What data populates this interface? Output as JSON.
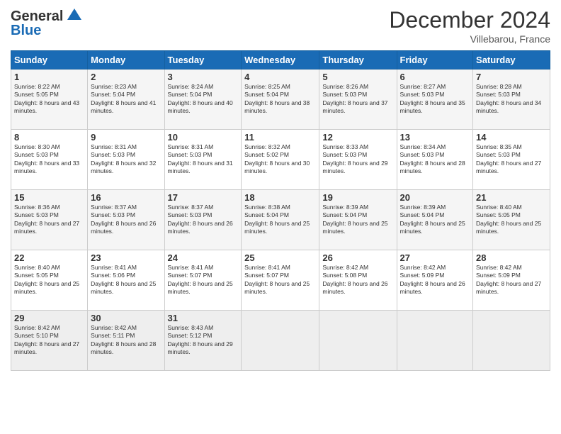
{
  "logo": {
    "line1": "General",
    "line2": "Blue"
  },
  "title": "December 2024",
  "subtitle": "Villebarou, France",
  "headers": [
    "Sunday",
    "Monday",
    "Tuesday",
    "Wednesday",
    "Thursday",
    "Friday",
    "Saturday"
  ],
  "weeks": [
    [
      {
        "day": "1",
        "sunrise": "8:22 AM",
        "sunset": "5:05 PM",
        "daylight": "8 hours and 43 minutes."
      },
      {
        "day": "2",
        "sunrise": "8:23 AM",
        "sunset": "5:04 PM",
        "daylight": "8 hours and 41 minutes."
      },
      {
        "day": "3",
        "sunrise": "8:24 AM",
        "sunset": "5:04 PM",
        "daylight": "8 hours and 40 minutes."
      },
      {
        "day": "4",
        "sunrise": "8:25 AM",
        "sunset": "5:04 PM",
        "daylight": "8 hours and 38 minutes."
      },
      {
        "day": "5",
        "sunrise": "8:26 AM",
        "sunset": "5:03 PM",
        "daylight": "8 hours and 37 minutes."
      },
      {
        "day": "6",
        "sunrise": "8:27 AM",
        "sunset": "5:03 PM",
        "daylight": "8 hours and 35 minutes."
      },
      {
        "day": "7",
        "sunrise": "8:28 AM",
        "sunset": "5:03 PM",
        "daylight": "8 hours and 34 minutes."
      }
    ],
    [
      {
        "day": "8",
        "sunrise": "8:30 AM",
        "sunset": "5:03 PM",
        "daylight": "8 hours and 33 minutes."
      },
      {
        "day": "9",
        "sunrise": "8:31 AM",
        "sunset": "5:03 PM",
        "daylight": "8 hours and 32 minutes."
      },
      {
        "day": "10",
        "sunrise": "8:31 AM",
        "sunset": "5:03 PM",
        "daylight": "8 hours and 31 minutes."
      },
      {
        "day": "11",
        "sunrise": "8:32 AM",
        "sunset": "5:02 PM",
        "daylight": "8 hours and 30 minutes."
      },
      {
        "day": "12",
        "sunrise": "8:33 AM",
        "sunset": "5:03 PM",
        "daylight": "8 hours and 29 minutes."
      },
      {
        "day": "13",
        "sunrise": "8:34 AM",
        "sunset": "5:03 PM",
        "daylight": "8 hours and 28 minutes."
      },
      {
        "day": "14",
        "sunrise": "8:35 AM",
        "sunset": "5:03 PM",
        "daylight": "8 hours and 27 minutes."
      }
    ],
    [
      {
        "day": "15",
        "sunrise": "8:36 AM",
        "sunset": "5:03 PM",
        "daylight": "8 hours and 27 minutes."
      },
      {
        "day": "16",
        "sunrise": "8:37 AM",
        "sunset": "5:03 PM",
        "daylight": "8 hours and 26 minutes."
      },
      {
        "day": "17",
        "sunrise": "8:37 AM",
        "sunset": "5:03 PM",
        "daylight": "8 hours and 26 minutes."
      },
      {
        "day": "18",
        "sunrise": "8:38 AM",
        "sunset": "5:04 PM",
        "daylight": "8 hours and 25 minutes."
      },
      {
        "day": "19",
        "sunrise": "8:39 AM",
        "sunset": "5:04 PM",
        "daylight": "8 hours and 25 minutes."
      },
      {
        "day": "20",
        "sunrise": "8:39 AM",
        "sunset": "5:04 PM",
        "daylight": "8 hours and 25 minutes."
      },
      {
        "day": "21",
        "sunrise": "8:40 AM",
        "sunset": "5:05 PM",
        "daylight": "8 hours and 25 minutes."
      }
    ],
    [
      {
        "day": "22",
        "sunrise": "8:40 AM",
        "sunset": "5:05 PM",
        "daylight": "8 hours and 25 minutes."
      },
      {
        "day": "23",
        "sunrise": "8:41 AM",
        "sunset": "5:06 PM",
        "daylight": "8 hours and 25 minutes."
      },
      {
        "day": "24",
        "sunrise": "8:41 AM",
        "sunset": "5:07 PM",
        "daylight": "8 hours and 25 minutes."
      },
      {
        "day": "25",
        "sunrise": "8:41 AM",
        "sunset": "5:07 PM",
        "daylight": "8 hours and 25 minutes."
      },
      {
        "day": "26",
        "sunrise": "8:42 AM",
        "sunset": "5:08 PM",
        "daylight": "8 hours and 26 minutes."
      },
      {
        "day": "27",
        "sunrise": "8:42 AM",
        "sunset": "5:09 PM",
        "daylight": "8 hours and 26 minutes."
      },
      {
        "day": "28",
        "sunrise": "8:42 AM",
        "sunset": "5:09 PM",
        "daylight": "8 hours and 27 minutes."
      }
    ],
    [
      {
        "day": "29",
        "sunrise": "8:42 AM",
        "sunset": "5:10 PM",
        "daylight": "8 hours and 27 minutes."
      },
      {
        "day": "30",
        "sunrise": "8:42 AM",
        "sunset": "5:11 PM",
        "daylight": "8 hours and 28 minutes."
      },
      {
        "day": "31",
        "sunrise": "8:43 AM",
        "sunset": "5:12 PM",
        "daylight": "8 hours and 29 minutes."
      },
      null,
      null,
      null,
      null
    ]
  ]
}
